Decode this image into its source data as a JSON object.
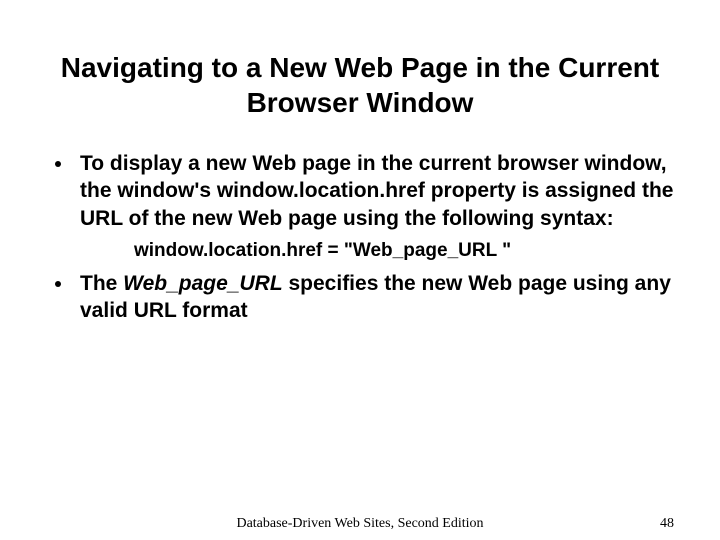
{
  "title": "Navigating to a New Web Page in the Current Browser Window",
  "bullets": {
    "b1_pre": "To display a new Web page in the current browser window, the window's window.location.href property is assigned the URL of the new Web page using the following syntax:",
    "code_line": "window.location.href = \"Web_page_URL \"",
    "b2_pre": "The ",
    "b2_em": "Web_page_URL",
    "b2_post": " specifies the new Web page using any valid URL format"
  },
  "footer": {
    "center": "Database-Driven Web Sites, Second Edition",
    "page": "48"
  }
}
